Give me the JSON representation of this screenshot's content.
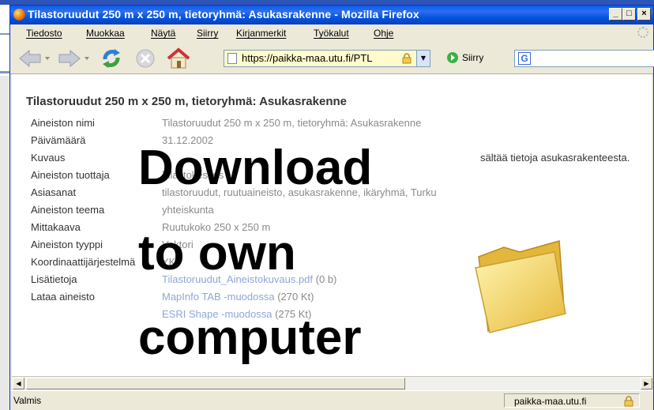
{
  "window": {
    "title": "Tilastoruudut 250 m x 250 m, tietoryhmä: Asukasrakenne - Mozilla Firefox",
    "controls": {
      "minimize": "_",
      "maximize": "□",
      "close": "×"
    }
  },
  "menubar": {
    "items": [
      "Tiedosto",
      "Muokkaa",
      "Näytä",
      "Siirry",
      "Kirjanmerkit",
      "Työkalut",
      "Ohje"
    ]
  },
  "navbar": {
    "url": "https://paikka-maa.utu.fi/PTL",
    "go_label": "Siirry",
    "icons": [
      "back-icon",
      "forward-icon",
      "reload-icon",
      "stop-icon",
      "home-icon",
      "page-icon",
      "lock-icon",
      "go-icon",
      "google-icon"
    ]
  },
  "page": {
    "heading": "Tilastoruudut 250 m x 250 m, tietoryhmä: Asukasrakenne",
    "rows": [
      {
        "label": "Aineiston nimi",
        "value": "Tilastoruudut 250 m x 250 m, tietoryhmä: Asukasrakenne"
      },
      {
        "label": "Päivämäärä",
        "value": "31.12.2002"
      },
      {
        "label": "Kuvaus",
        "value": "sältää tietoja asukasrakenteesta."
      },
      {
        "label": "Aineiston tuottaja",
        "value": "Tilastokeskus"
      },
      {
        "label": "Asiasanat",
        "value": "tilastoruudut, ruutuaineisto, asukasrakenne, ikäryhmä, Turku"
      },
      {
        "label": "Aineiston teema",
        "value": "yhteiskunta"
      },
      {
        "label": "Mittakaava",
        "value": "Ruutukoko 250 x 250 m"
      },
      {
        "label": "Aineiston tyyppi",
        "value": "Vektori"
      },
      {
        "label": "Koordinaattijärjestelmä",
        "value": "YKJ"
      },
      {
        "label": "Lisätietoja",
        "value": "Tilastoruudut_Aineistokuvaus.pdf",
        "suffix": " (0 b)"
      },
      {
        "label": "Lataa aineisto",
        "value": "MapInfo TAB -muodossa",
        "suffix": " (270 Kt)"
      },
      {
        "label": "",
        "value": "ESRI Shape -muodossa",
        "suffix": " (275 Kt)"
      }
    ]
  },
  "overlay": {
    "line1": "Download",
    "line2": "to own",
    "line3": "computer"
  },
  "statusbar": {
    "status": "Valmis",
    "host": "paikka-maa.utu.fi"
  },
  "colors": {
    "titlebar": "#0a5be6",
    "chrome": "#ece9d8",
    "link": "#8fa6d8",
    "value_text": "#8a8a8a",
    "url_bg": "#fffbcc"
  }
}
